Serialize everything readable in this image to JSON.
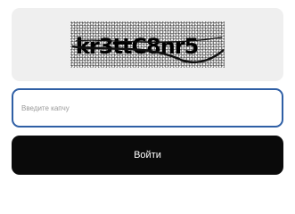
{
  "captcha": {
    "image_text": "kr3ttC8nr5"
  },
  "form": {
    "input_placeholder": "Введите капчу",
    "input_value": "",
    "submit_label": "Войти"
  }
}
